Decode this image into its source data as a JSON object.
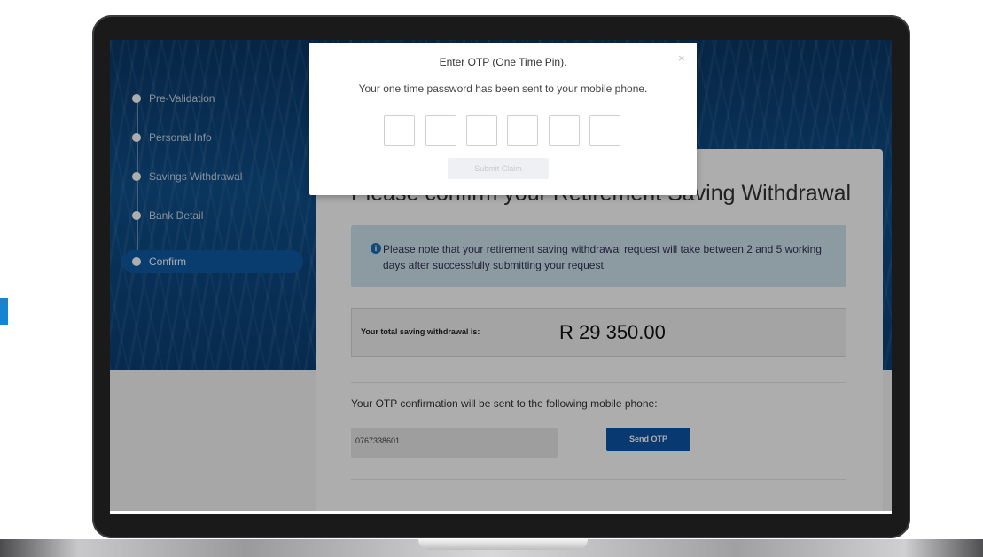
{
  "sidebar": {
    "steps": [
      {
        "label": "Pre-Validation"
      },
      {
        "label": "Personal Info"
      },
      {
        "label": "Savings Withdrawal"
      },
      {
        "label": "Bank Detail"
      },
      {
        "label": "Confirm"
      }
    ],
    "active_step": "Confirm"
  },
  "card": {
    "title": "Please confirm your Retirement Saving Withdrawal",
    "notice": "Please note that your retirement saving withdrawal request will take between 2 and 5 working days after successfully submitting your request.",
    "total_label": "Your total saving withdrawal is:",
    "total_amount": "R 29 350.00",
    "otp_label": "Your OTP confirmation will be sent to the following mobile phone:",
    "phone_value": "0767338601",
    "send_button": "Send OTP"
  },
  "modal": {
    "title": "Enter OTP (One Time Pin).",
    "close": "×",
    "subtitle": "Your one time password has been sent to your mobile phone.",
    "pin_count": 6,
    "submit_button": "Submit Claim"
  },
  "colors": {
    "brand_blue": "#0c55a5",
    "accent": "#1584d1",
    "notice_bg": "#cfe3ef"
  }
}
